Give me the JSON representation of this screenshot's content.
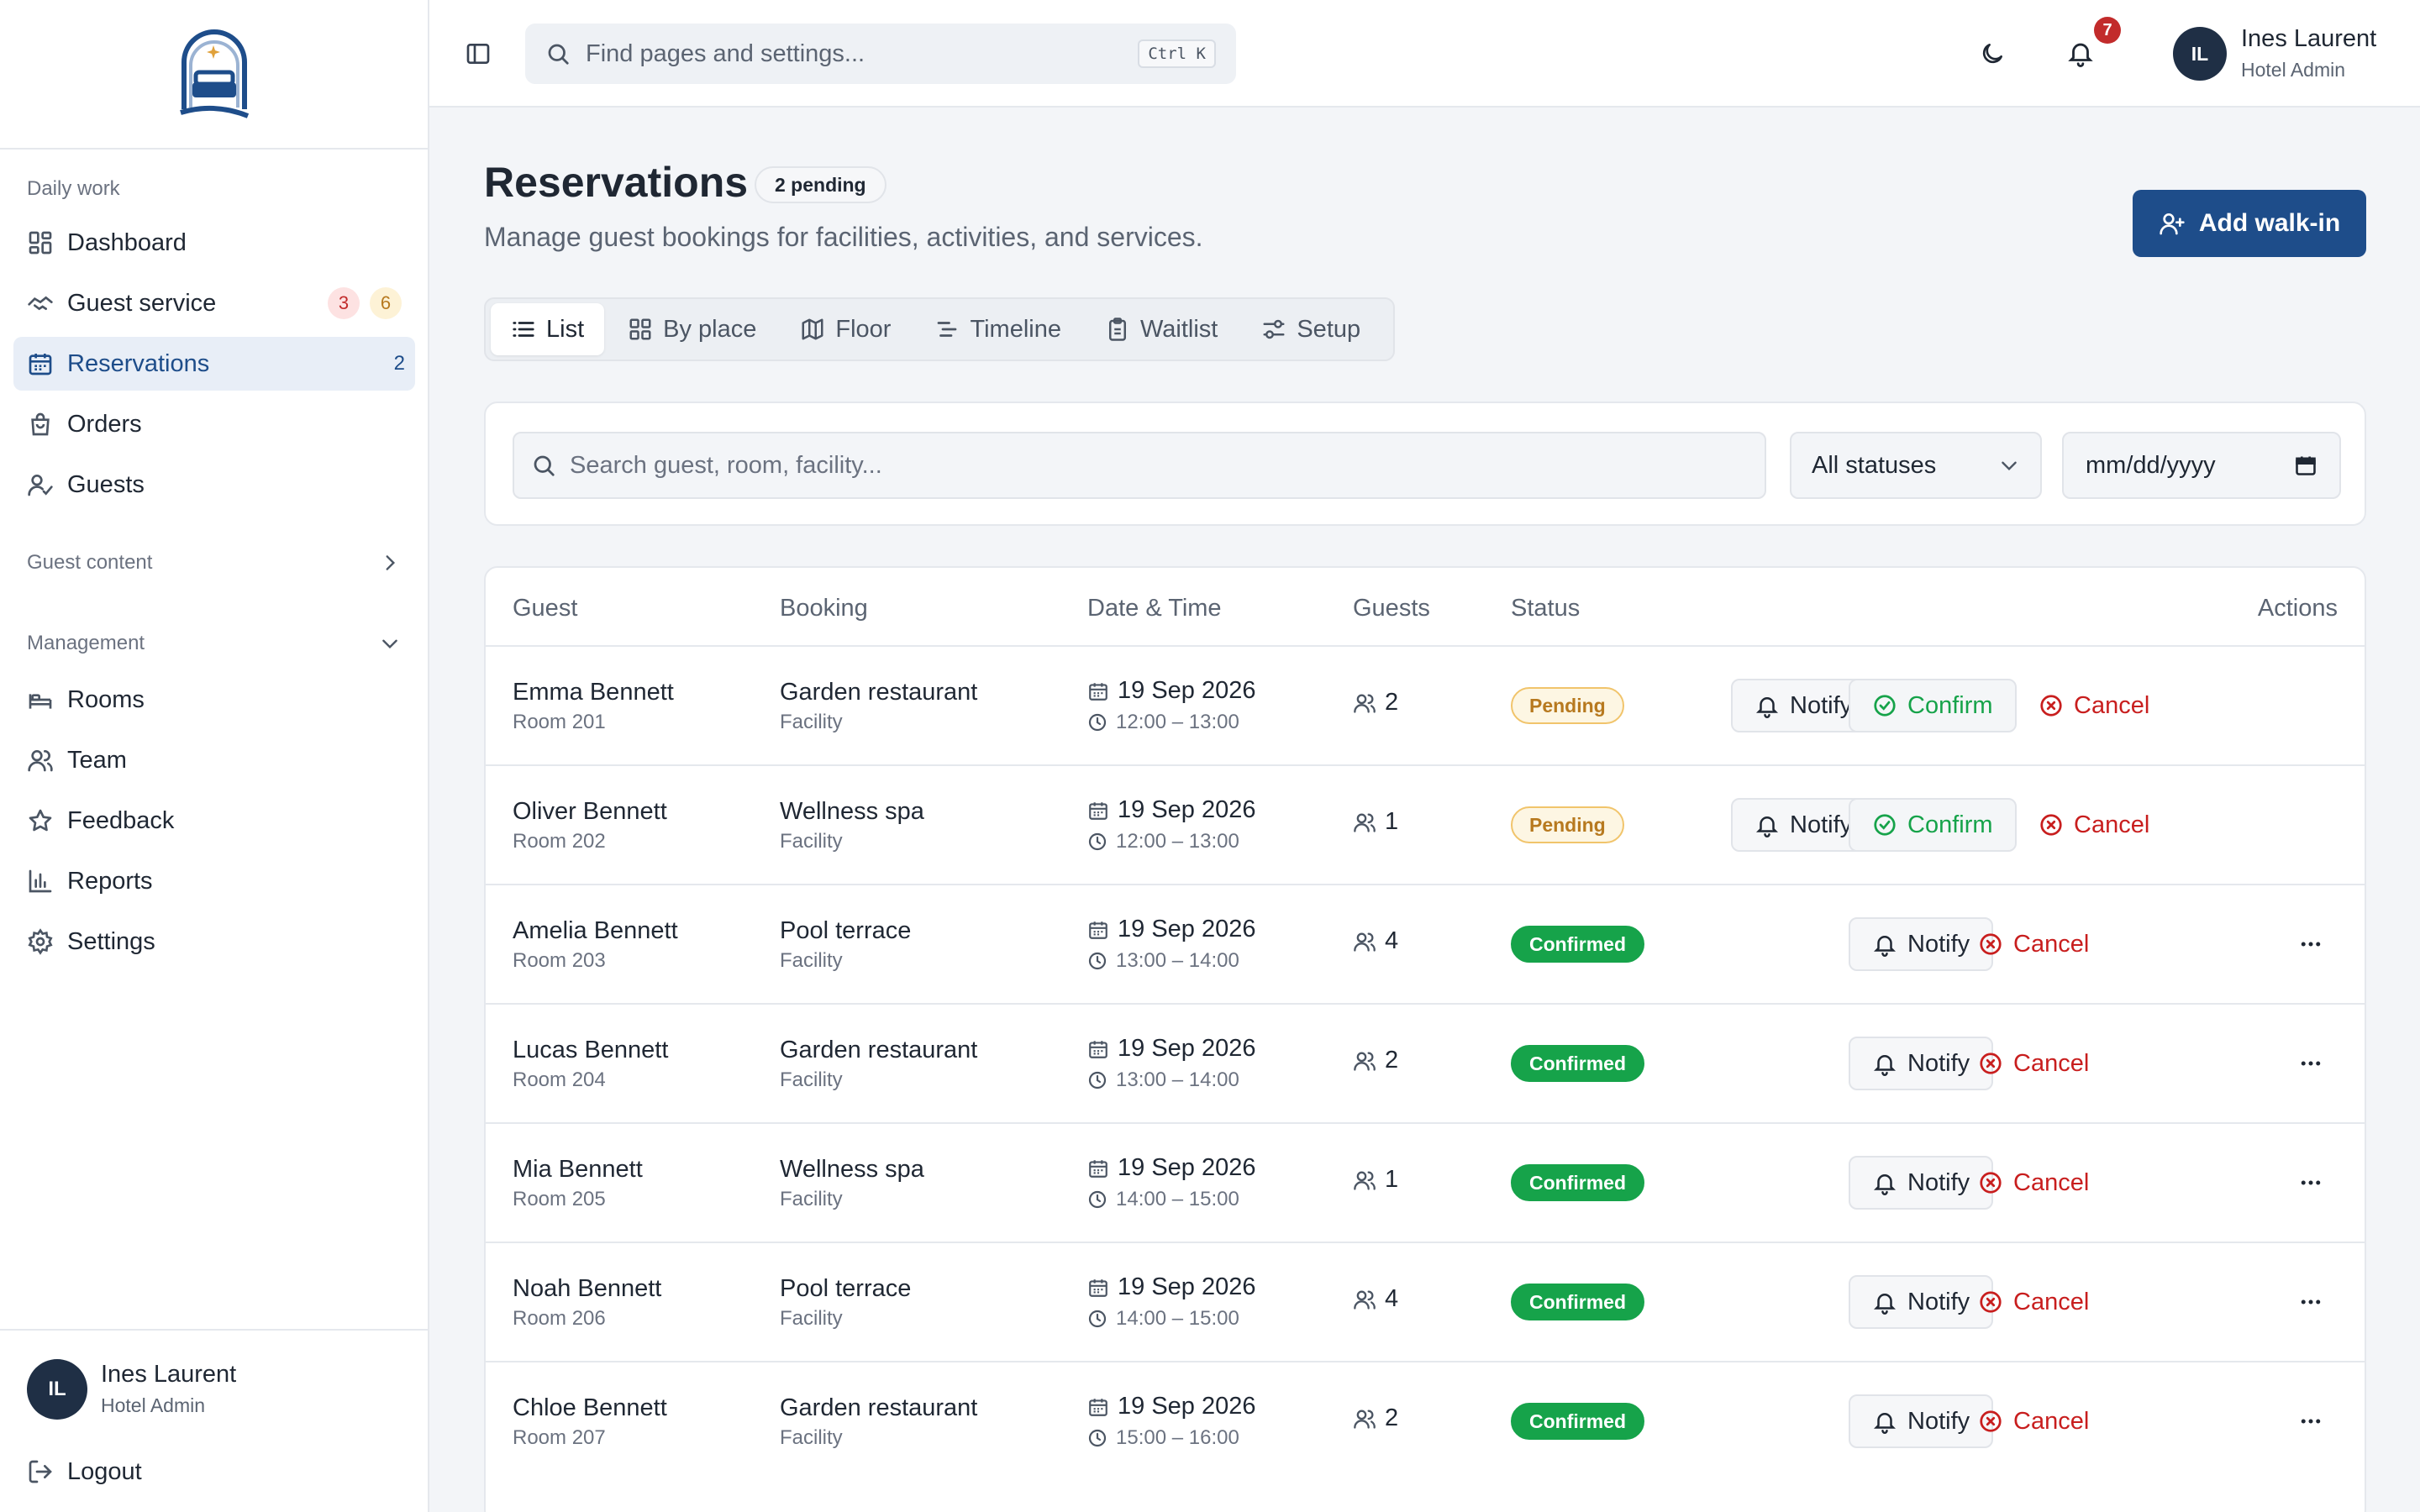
{
  "colors": {
    "accent": "#1e4d8a",
    "confirmed": "#16a34a",
    "pending": "#b7791f",
    "cancel": "#c81e1e",
    "badge_red": "#c22b2b"
  },
  "sidebar": {
    "section_daily": "Daily work",
    "items_daily": [
      {
        "label": "Dashboard",
        "icon": "grid-icon"
      },
      {
        "label": "Guest service",
        "icon": "handshake-icon",
        "badge_red": "3",
        "badge_amber": "6"
      },
      {
        "label": "Reservations",
        "icon": "calendar-icon",
        "count": "2",
        "active": true
      },
      {
        "label": "Orders",
        "icon": "shopping-bag-icon"
      },
      {
        "label": "Guests",
        "icon": "user-check-icon"
      }
    ],
    "section_content": "Guest content",
    "section_management": "Management",
    "items_management": [
      {
        "label": "Rooms",
        "icon": "bed-icon"
      },
      {
        "label": "Team",
        "icon": "users-icon"
      },
      {
        "label": "Feedback",
        "icon": "star-icon"
      },
      {
        "label": "Reports",
        "icon": "bar-chart-icon"
      },
      {
        "label": "Settings",
        "icon": "gear-icon"
      }
    ],
    "user": {
      "initials": "IL",
      "name": "Ines Laurent",
      "role": "Hotel Admin"
    },
    "logout": "Logout"
  },
  "topbar": {
    "search_placeholder": "Find pages and settings...",
    "shortcut": "Ctrl K",
    "notification_count": "7",
    "user": {
      "initials": "IL",
      "name": "Ines Laurent",
      "role": "Hotel Admin"
    }
  },
  "page": {
    "title": "Reservations",
    "pending_badge": "2 pending",
    "subtitle": "Manage guest bookings for facilities, activities, and services.",
    "add_button": "Add walk-in"
  },
  "tabs": [
    {
      "label": "List",
      "icon": "list-icon",
      "active": true
    },
    {
      "label": "By place",
      "icon": "grid-icon"
    },
    {
      "label": "Floor",
      "icon": "map-icon"
    },
    {
      "label": "Timeline",
      "icon": "timeline-icon"
    },
    {
      "label": "Waitlist",
      "icon": "clipboard-icon"
    },
    {
      "label": "Setup",
      "icon": "sliders-icon"
    }
  ],
  "filters": {
    "search_placeholder": "Search guest, room, facility...",
    "status_selected": "All statuses",
    "date_placeholder": "mm/dd/yyyy"
  },
  "table": {
    "headers": {
      "guest": "Guest",
      "booking": "Booking",
      "datetime": "Date & Time",
      "guests": "Guests",
      "status": "Status",
      "actions": "Actions"
    },
    "actions": {
      "notify": "Notify",
      "confirm": "Confirm",
      "cancel": "Cancel"
    },
    "rows": [
      {
        "guest": "Emma Bennett",
        "room": "Room 201",
        "booking": "Garden restaurant",
        "type": "Facility",
        "date": "19 Sep 2026",
        "time": "12:00 – 13:00",
        "guests": "2",
        "status": "Pending"
      },
      {
        "guest": "Oliver Bennett",
        "room": "Room 202",
        "booking": "Wellness spa",
        "type": "Facility",
        "date": "19 Sep 2026",
        "time": "12:00 – 13:00",
        "guests": "1",
        "status": "Pending"
      },
      {
        "guest": "Amelia Bennett",
        "room": "Room 203",
        "booking": "Pool terrace",
        "type": "Facility",
        "date": "19 Sep 2026",
        "time": "13:00 – 14:00",
        "guests": "4",
        "status": "Confirmed"
      },
      {
        "guest": "Lucas Bennett",
        "room": "Room 204",
        "booking": "Garden restaurant",
        "type": "Facility",
        "date": "19 Sep 2026",
        "time": "13:00 – 14:00",
        "guests": "2",
        "status": "Confirmed"
      },
      {
        "guest": "Mia Bennett",
        "room": "Room 205",
        "booking": "Wellness spa",
        "type": "Facility",
        "date": "19 Sep 2026",
        "time": "14:00 – 15:00",
        "guests": "1",
        "status": "Confirmed"
      },
      {
        "guest": "Noah Bennett",
        "room": "Room 206",
        "booking": "Pool terrace",
        "type": "Facility",
        "date": "19 Sep 2026",
        "time": "14:00 – 15:00",
        "guests": "4",
        "status": "Confirmed"
      },
      {
        "guest": "Chloe Bennett",
        "room": "Room 207",
        "booking": "Garden restaurant",
        "type": "Facility",
        "date": "19 Sep 2026",
        "time": "15:00 – 16:00",
        "guests": "2",
        "status": "Confirmed"
      }
    ]
  }
}
